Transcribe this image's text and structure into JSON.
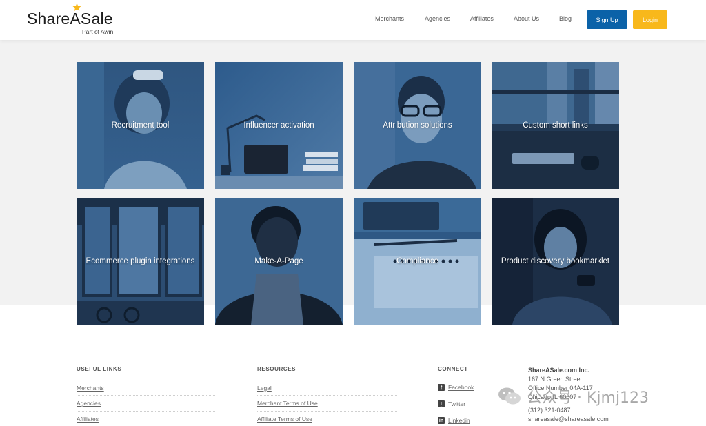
{
  "brand": {
    "name": "ShareASale",
    "tagline": "Part of Awin",
    "star_color": "#f8b81b"
  },
  "nav": {
    "items": [
      "Merchants",
      "Agencies",
      "Affiliates",
      "About Us",
      "Blog"
    ],
    "signup_label": "Sign Up",
    "login_label": "Login",
    "signup_color": "#0b62a8",
    "login_color": "#f8b81b"
  },
  "tiles": [
    {
      "label": "Recruitment tool"
    },
    {
      "label": "Influencer activation"
    },
    {
      "label": "Attribution solutions"
    },
    {
      "label": "Custom short links"
    },
    {
      "label": "Ecommerce plugin integrations"
    },
    {
      "label": "Make-A-Page"
    },
    {
      "label": "Compliance"
    },
    {
      "label": "Product discovery bookmarklet"
    }
  ],
  "footer": {
    "useful_links": {
      "heading": "USEFUL LINKS",
      "items": [
        "Merchants",
        "Agencies",
        "Affiliates"
      ]
    },
    "resources": {
      "heading": "RESOURCES",
      "items": [
        "Legal",
        "Merchant Terms of Use",
        "Affiliate Terms of Use"
      ]
    },
    "connect": {
      "heading": "CONNECT",
      "items": [
        {
          "label": "Facebook",
          "icon": "facebook-icon"
        },
        {
          "label": "Twitter",
          "icon": "twitter-icon"
        },
        {
          "label": "Linkedin",
          "icon": "linkedin-icon"
        }
      ]
    },
    "address": {
      "company": "ShareASale.com Inc.",
      "street": "167 N Green Street",
      "office": "Office Number 04A-117",
      "city": "Chicago IL 60607",
      "phone": "(312) 321-0487",
      "email": "shareasale@shareasale.com"
    }
  },
  "watermark": {
    "text": "公众号 · Kjmj123",
    "icon": "wechat-icon"
  }
}
